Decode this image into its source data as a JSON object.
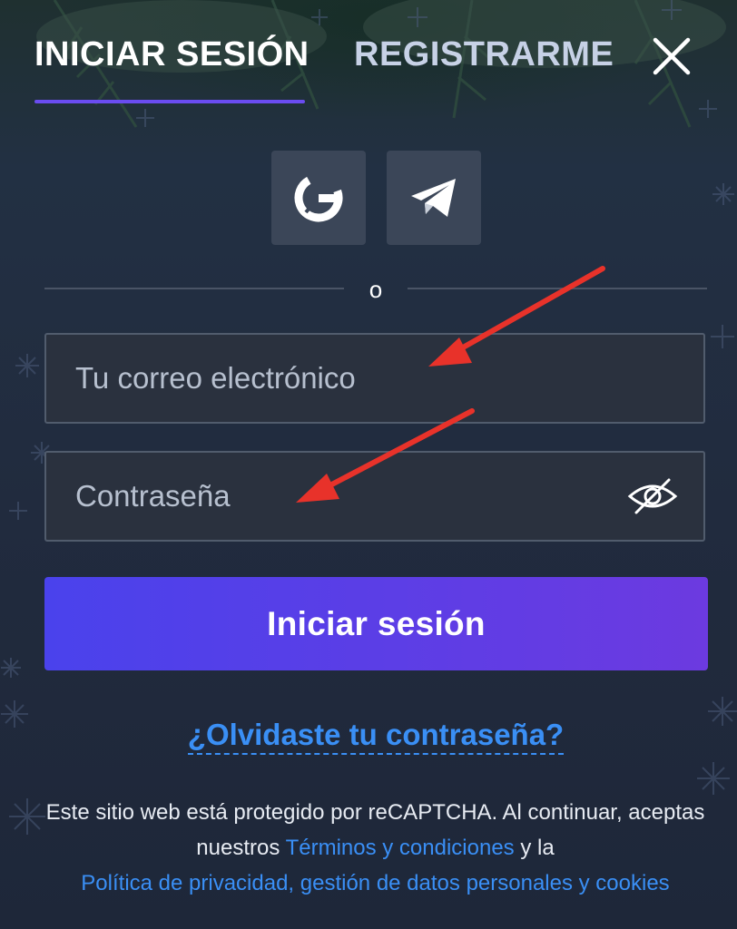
{
  "tabs": {
    "login": "INICIAR SESIÓN",
    "register": "REGISTRARME"
  },
  "social": {
    "buttons": [
      {
        "icon": "google-icon"
      },
      {
        "icon": "telegram-icon"
      }
    ]
  },
  "divider": {
    "or_label": "o"
  },
  "form": {
    "email_placeholder": "Tu correo electrónico",
    "password_placeholder": "Contraseña",
    "submit_label": "Iniciar sesión"
  },
  "forgot_password": "¿Olvidaste tu contraseña?",
  "legal": {
    "text_1": "Este sitio web está protegido por reCAPTCHA. Al continuar, aceptas nuestros",
    "terms_link": "Términos y condiciones",
    "text_2": "y la",
    "privacy_link": "Política de privacidad, gestión de datos personales y cookies"
  },
  "colors": {
    "background": "#202a3c",
    "accent": "#6a4cf0",
    "button_gradient_start": "#4a42ec",
    "button_gradient_end": "#6c3ae0",
    "link": "#3a8ff5",
    "annotation_arrow": "#e8322a"
  }
}
